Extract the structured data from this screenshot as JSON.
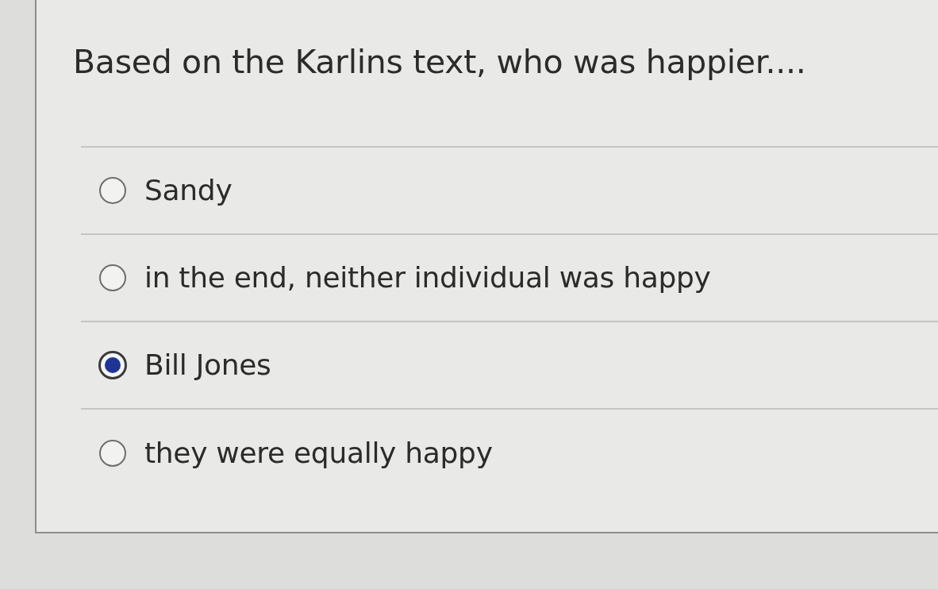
{
  "question": {
    "text": "Based on the Karlins text, who was happier...."
  },
  "options": [
    {
      "label": "Sandy",
      "selected": false
    },
    {
      "label": "in the end, neither individual was happy",
      "selected": false
    },
    {
      "label": "Bill Jones",
      "selected": true
    },
    {
      "label": "they were equally happy",
      "selected": false
    }
  ]
}
